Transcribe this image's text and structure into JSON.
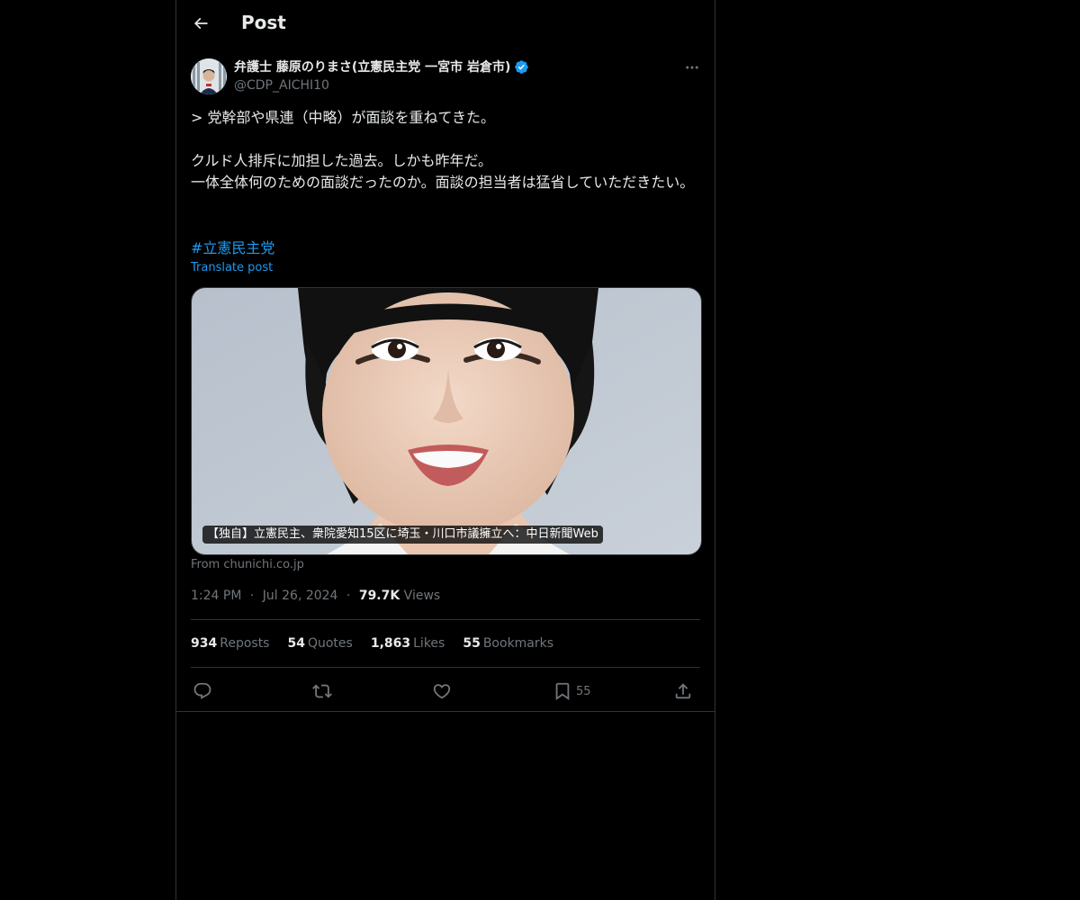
{
  "header": {
    "title": "Post"
  },
  "author": {
    "name": "弁護士 藤原のりまさ(立憲民主党 一宮市 岩倉市)",
    "handle": "@CDP_AICHI10",
    "verified": true
  },
  "tweet": {
    "lines": [
      "> 党幹部や県連（中略）が面談を重ねてきた。",
      "クルド人排斥に加担した過去。しかも昨年だ。",
      "一体全体何のための面談だったのか。面談の担当者は猛省していただきたい。"
    ],
    "hashtag": "#立憲民主党",
    "translate_label": "Translate post"
  },
  "card": {
    "caption": "【独自】立憲民主、衆院愛知15区に埼玉・川口市議擁立へ：中日新聞Web",
    "source": "From chunichi.co.jp"
  },
  "meta": {
    "time": "1:24 PM",
    "date": "Jul 26, 2024",
    "views_count": "79.7K",
    "views_label": "Views",
    "separator": "·"
  },
  "stats": {
    "reposts_count": "934",
    "reposts_label": "Reposts",
    "quotes_count": "54",
    "quotes_label": "Quotes",
    "likes_count": "1,863",
    "likes_label": "Likes",
    "bookmarks_count": "55",
    "bookmarks_label": "Bookmarks"
  },
  "actions": {
    "bookmark_count": "55"
  },
  "colors": {
    "background": "#000000",
    "text": "#e7e9ea",
    "muted": "#71767b",
    "accent": "#1d9bf0",
    "border": "#2f3336"
  },
  "icons": {
    "back": "arrow-left-icon",
    "more": "more-horizontal-icon",
    "verified": "verified-badge-icon",
    "reply": "reply-icon",
    "repost": "repost-icon",
    "like": "heart-icon",
    "bookmark": "bookmark-icon",
    "share": "share-icon"
  }
}
